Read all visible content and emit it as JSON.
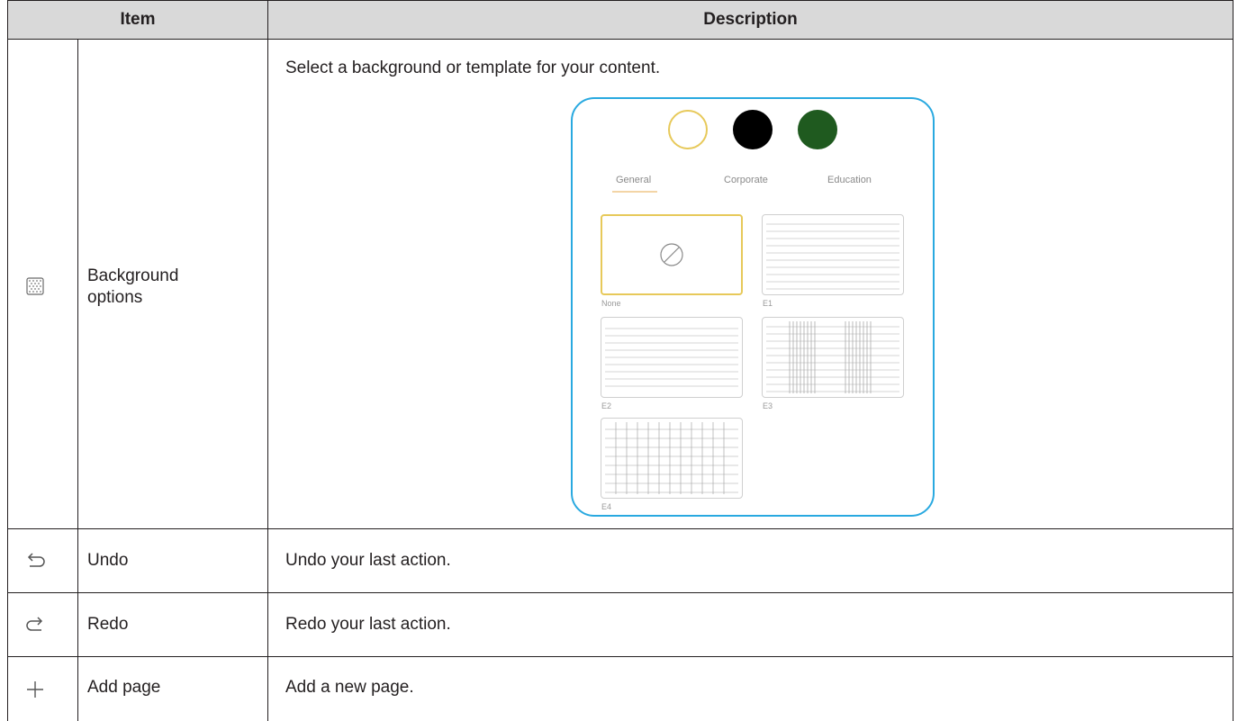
{
  "table": {
    "header_item": "Item",
    "header_description": "Description",
    "rows": [
      {
        "name_line1": "Background",
        "name_line2": "options",
        "icon": "dotted-pattern-icon",
        "description": "Select a background or template for your content."
      },
      {
        "name": "Undo",
        "icon": "undo-icon",
        "description": "Undo your last action."
      },
      {
        "name": "Redo",
        "icon": "redo-icon",
        "description": "Redo your last action."
      },
      {
        "name": "Add page",
        "icon": "plus-icon",
        "description": "Add a new page."
      }
    ]
  },
  "panel": {
    "swatches": [
      {
        "color": "#ffffff",
        "border": "#e7c95a"
      },
      {
        "color": "#000000"
      },
      {
        "color": "#1f5a1f"
      }
    ],
    "tabs": [
      "General",
      "Corporate",
      "Education"
    ],
    "thumbnails": [
      {
        "label": "None",
        "kind": "none"
      },
      {
        "label": "E1",
        "kind": "lines"
      },
      {
        "label": "E2",
        "kind": "lines"
      },
      {
        "label": "E3",
        "kind": "grid-dense"
      },
      {
        "label": "E4",
        "kind": "grid"
      }
    ],
    "colors": {
      "border": "#29a9e0",
      "selected": "#e7c95a"
    }
  }
}
